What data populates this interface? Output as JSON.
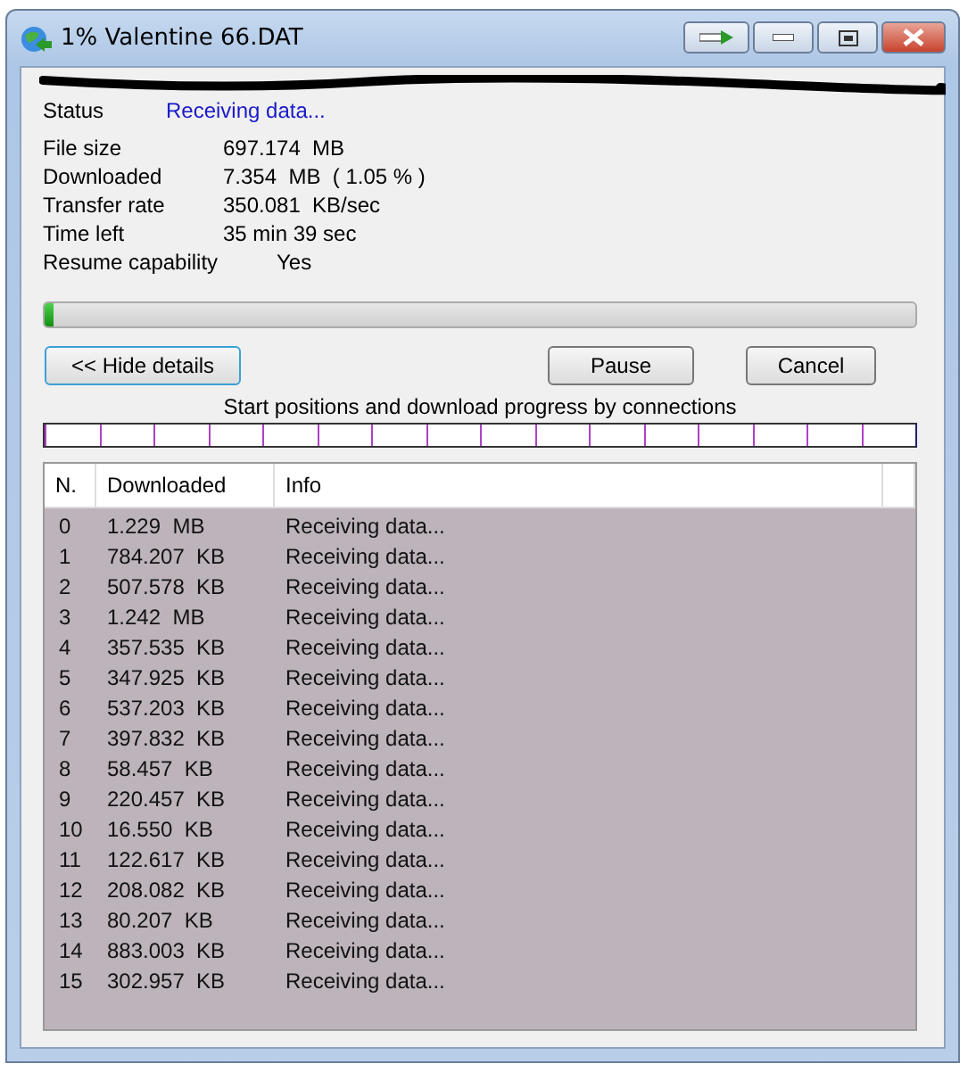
{
  "window": {
    "title": "1% Valentine 66.DAT"
  },
  "status": {
    "label": "Status",
    "value": "Receiving data..."
  },
  "details": [
    {
      "label": "File size",
      "value": "697.174  MB"
    },
    {
      "label": "Downloaded",
      "value": "7.354  MB  ( 1.05 % )"
    },
    {
      "label": "Transfer rate",
      "value": "350.081  KB/sec"
    },
    {
      "label": "Time left",
      "value": "35 min 39 sec"
    },
    {
      "label": "Resume capability",
      "value": "Yes",
      "kind": "indented"
    }
  ],
  "progress": {
    "level": 0.0105
  },
  "buttons": {
    "hide_details": "<< Hide details",
    "pause": "Pause",
    "cancel": "Cancel"
  },
  "connections_caption": "Start positions and download progress by connections",
  "table": {
    "columns": [
      "N.",
      "Downloaded",
      "Info"
    ],
    "rows": [
      [
        "0",
        "1.229  MB",
        "Receiving data..."
      ],
      [
        "1",
        "784.207  KB",
        "Receiving data..."
      ],
      [
        "2",
        "507.578  KB",
        "Receiving data..."
      ],
      [
        "3",
        "1.242  MB",
        "Receiving data..."
      ],
      [
        "4",
        "357.535  KB",
        "Receiving data..."
      ],
      [
        "5",
        "347.925  KB",
        "Receiving data..."
      ],
      [
        "6",
        "537.203  KB",
        "Receiving data..."
      ],
      [
        "7",
        "397.832  KB",
        "Receiving data..."
      ],
      [
        "8",
        "58.457  KB",
        "Receiving data..."
      ],
      [
        "9",
        "220.457  KB",
        "Receiving data..."
      ],
      [
        "10",
        "16.550  KB",
        "Receiving data..."
      ],
      [
        "11",
        "122.617  KB",
        "Receiving data..."
      ],
      [
        "12",
        "208.082  KB",
        "Receiving data..."
      ],
      [
        "13",
        "80.207  KB",
        "Receiving data..."
      ],
      [
        "14",
        "883.003  KB",
        "Receiving data..."
      ],
      [
        "15",
        "302.957  KB",
        "Receiving data..."
      ]
    ]
  }
}
